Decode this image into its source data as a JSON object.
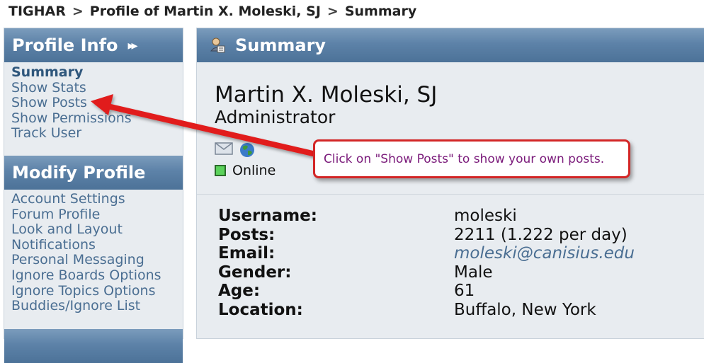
{
  "breadcrumb": {
    "items": [
      "TIGHAR",
      "Profile of Martin X. Moleski, SJ",
      "Summary"
    ],
    "separator": ">"
  },
  "sidebar": {
    "profile_info": {
      "title": "Profile Info",
      "items": [
        "Summary",
        "Show Stats",
        "Show Posts",
        "Show Permissions",
        "Track User"
      ]
    },
    "modify_profile": {
      "title": "Modify Profile",
      "items": [
        "Account Settings",
        "Forum Profile",
        "Look and Layout",
        "Notifications",
        "Personal Messaging",
        "Ignore Boards Options",
        "Ignore Topics Options",
        "Buddies/Ignore List"
      ]
    }
  },
  "main": {
    "header_title": "Summary",
    "name": "Martin X. Moleski, SJ",
    "role": "Administrator",
    "status": "Online",
    "info": {
      "username_label": "Username:",
      "username": "moleski",
      "posts_label": "Posts:",
      "posts": "2211 (1.222 per day)",
      "email_label": "Email:",
      "email": "moleski@canisius.edu",
      "gender_label": "Gender:",
      "gender": "Male",
      "age_label": "Age:",
      "age": "61",
      "location_label": "Location:",
      "location": "Buffalo, New York"
    }
  },
  "callout": {
    "text": "Click on \"Show Posts\" to show your own posts."
  },
  "colors": {
    "header_blue": "#5d82a8",
    "panel_bg": "#e8ecf0",
    "link": "#4a6e92",
    "callout_border": "#d32626",
    "callout_text": "#7a1a7a",
    "online": "#5bd25b"
  },
  "icons": [
    "user-profile-icon",
    "email-icon",
    "globe-icon",
    "online-status-icon",
    "double-chevron-right-icon"
  ]
}
